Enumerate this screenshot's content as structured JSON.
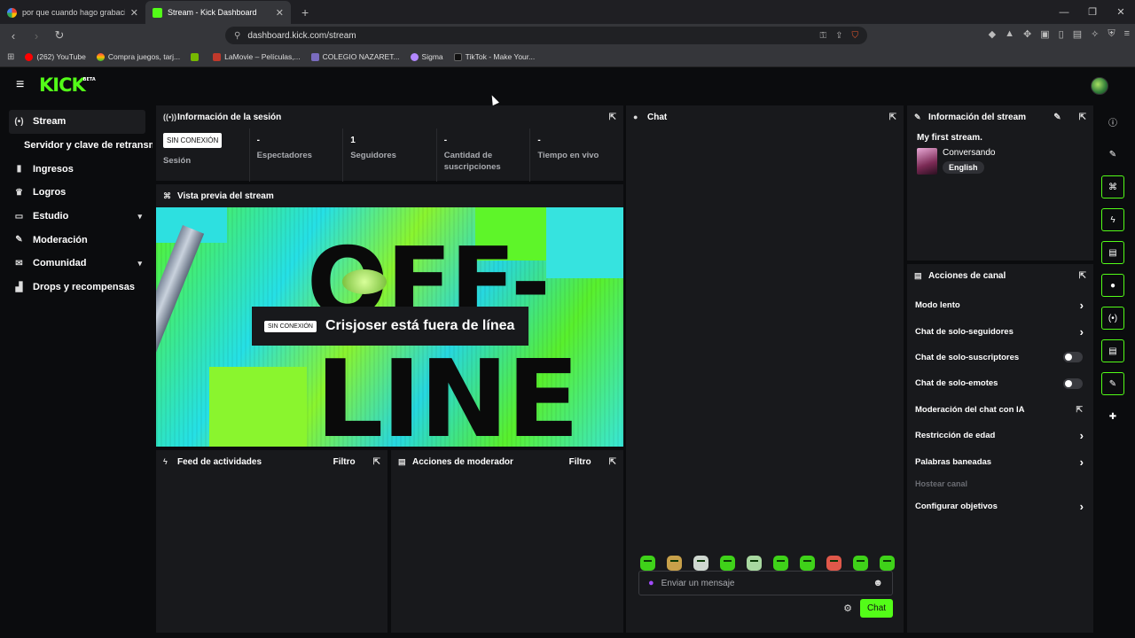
{
  "browser": {
    "tabs": [
      {
        "title": "por que cuando hago grabacion de p",
        "active": false
      },
      {
        "title": "Stream - Kick Dashboard",
        "active": true
      }
    ],
    "new_tab": "+",
    "url": "dashboard.kick.com/stream",
    "bookmarks": [
      "(262) YouTube",
      "Compra juegos, tarj...",
      "",
      "LaMovie – Películas,...",
      "COLEGIO NAZARET...",
      "Sigma",
      "TikTok - Make Your..."
    ]
  },
  "app": {
    "logo": "KICK",
    "logo_badge": "BETA",
    "sidebar": [
      {
        "label": "Stream",
        "icon": "stream-icon",
        "glyph": "(•)",
        "active": true
      },
      {
        "label": "Servidor y clave de retransmisión",
        "icon": "",
        "glyph": "",
        "sub": true
      },
      {
        "label": "Ingresos",
        "icon": "chart-icon",
        "glyph": "▮"
      },
      {
        "label": "Logros",
        "icon": "trophy-icon",
        "glyph": "♛"
      },
      {
        "label": "Estudio",
        "icon": "studio-icon",
        "glyph": "▭",
        "chevron": "⌄"
      },
      {
        "label": "Moderación",
        "icon": "wrench-icon",
        "glyph": "✎"
      },
      {
        "label": "Comunidad",
        "icon": "community-icon",
        "glyph": "✉",
        "chevron": "⌄"
      },
      {
        "label": "Drops y recompensas",
        "icon": "drops-icon",
        "glyph": "▟"
      }
    ],
    "session": {
      "title": "Información de la sesión",
      "stats": [
        {
          "value": "SIN CONEXIÓN",
          "label": "Sesión",
          "badge": true
        },
        {
          "value": "-",
          "label": "Espectadores"
        },
        {
          "value": "1",
          "label": "Seguidores"
        },
        {
          "value": "-",
          "label": "Cantidad de suscripciones"
        },
        {
          "value": "-",
          "label": "Tiempo en vivo"
        }
      ]
    },
    "preview": {
      "title": "Vista previa del stream",
      "badge": "SIN CONEXIÓN",
      "message": "Crisjoser está fuera de línea",
      "art_top": "OFF-",
      "art_bottom": "LINE"
    },
    "activity_feed": {
      "title": "Feed de actividades",
      "filter": "Filtro"
    },
    "mod_actions": {
      "title": "Acciones de moderador",
      "filter": "Filtro"
    },
    "chat": {
      "title": "Chat",
      "placeholder": "Enviar un mensaje",
      "send": "Chat"
    },
    "stream_info": {
      "title": "Información del stream",
      "stream_title": "My first stream.",
      "category": "Conversando",
      "language": "English"
    },
    "channel_actions": {
      "title": "Acciones de canal",
      "items": [
        {
          "label": "Modo lento",
          "kind": "arrow"
        },
        {
          "label": "Chat de solo-seguidores",
          "kind": "arrow"
        },
        {
          "label": "Chat de solo-suscriptores",
          "kind": "toggle"
        },
        {
          "label": "Chat de solo-emotes",
          "kind": "toggle"
        },
        {
          "label": "Moderación del chat con IA",
          "kind": "external"
        },
        {
          "label": "Restricción de edad",
          "kind": "arrow"
        },
        {
          "label": "Palabras baneadas",
          "kind": "arrow"
        },
        {
          "label": "Hostear canal",
          "kind": "disabled"
        },
        {
          "label": "Configurar objetivos",
          "kind": "arrow"
        }
      ]
    },
    "colors": {
      "accent": "#53fc18",
      "panel": "#18191c",
      "background": "#0b0c0e"
    }
  }
}
